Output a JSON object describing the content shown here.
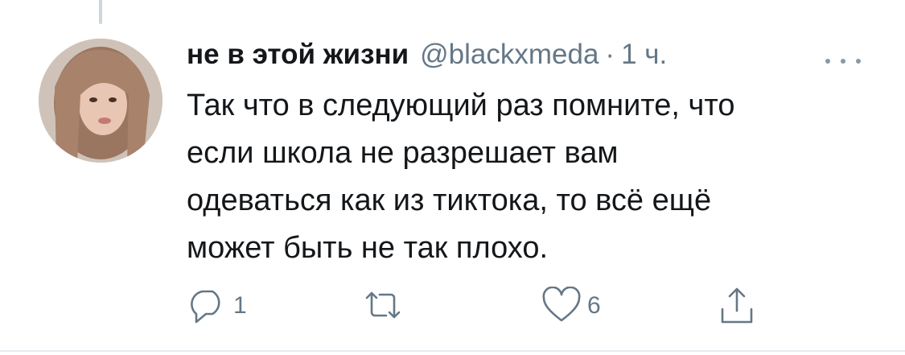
{
  "tweet": {
    "author_name": "не в этой жизни",
    "handle": "@blackxmeda",
    "separator": "·",
    "time": "1 ч.",
    "text_lines": [
      "Так что в следующий раз помните, что",
      "если школа не разрешает вам",
      "одеваться как из тиктока, то всё ещё",
      "может быть не так плохо."
    ]
  },
  "actions": {
    "reply_count": "1",
    "retweet_count": "",
    "like_count": "6"
  },
  "icons": {
    "more": "more-horizontal-icon",
    "reply": "reply-icon",
    "retweet": "retweet-icon",
    "like": "heart-icon",
    "share": "share-icon"
  },
  "colors": {
    "text_primary": "#14171a",
    "text_secondary": "#657786",
    "divider": "#e6ecf0"
  }
}
